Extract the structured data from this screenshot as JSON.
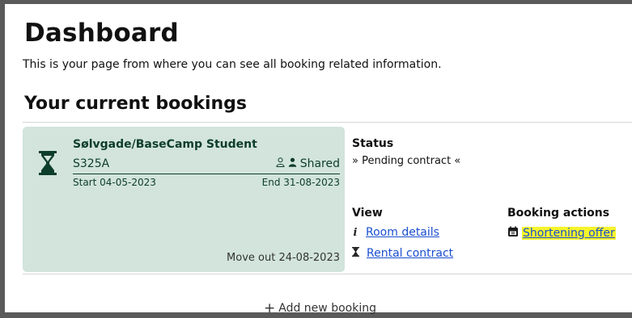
{
  "page": {
    "title": "Dashboard",
    "subtitle": "This is your page from where you can see all booking related information.",
    "section_title": "Your current bookings"
  },
  "booking": {
    "property": "Sølvgade/BaseCamp Student",
    "room": "S325A",
    "shared_label": "Shared",
    "start": "Start 04-05-2023",
    "end": "End 31-08-2023",
    "move_out": "Move out 24-08-2023",
    "status_label": "Status",
    "status_value": "» Pending contract «",
    "view_label": "View",
    "view_links": [
      {
        "label": "Room details",
        "icon": "info-icon"
      },
      {
        "label": "Rental contract",
        "icon": "hourglass-icon"
      }
    ],
    "actions_label": "Booking actions",
    "actions": [
      {
        "label": "Shortening offer",
        "icon": "calendar-icon",
        "highlighted": true
      }
    ]
  },
  "add_booking": {
    "label": "Add new booking",
    "icon": "plus-icon"
  },
  "colors": {
    "card_bg": "#d2e4dc",
    "card_text": "#0d3d2b",
    "link": "#1a4fcf",
    "highlight": "#f6f42b"
  }
}
